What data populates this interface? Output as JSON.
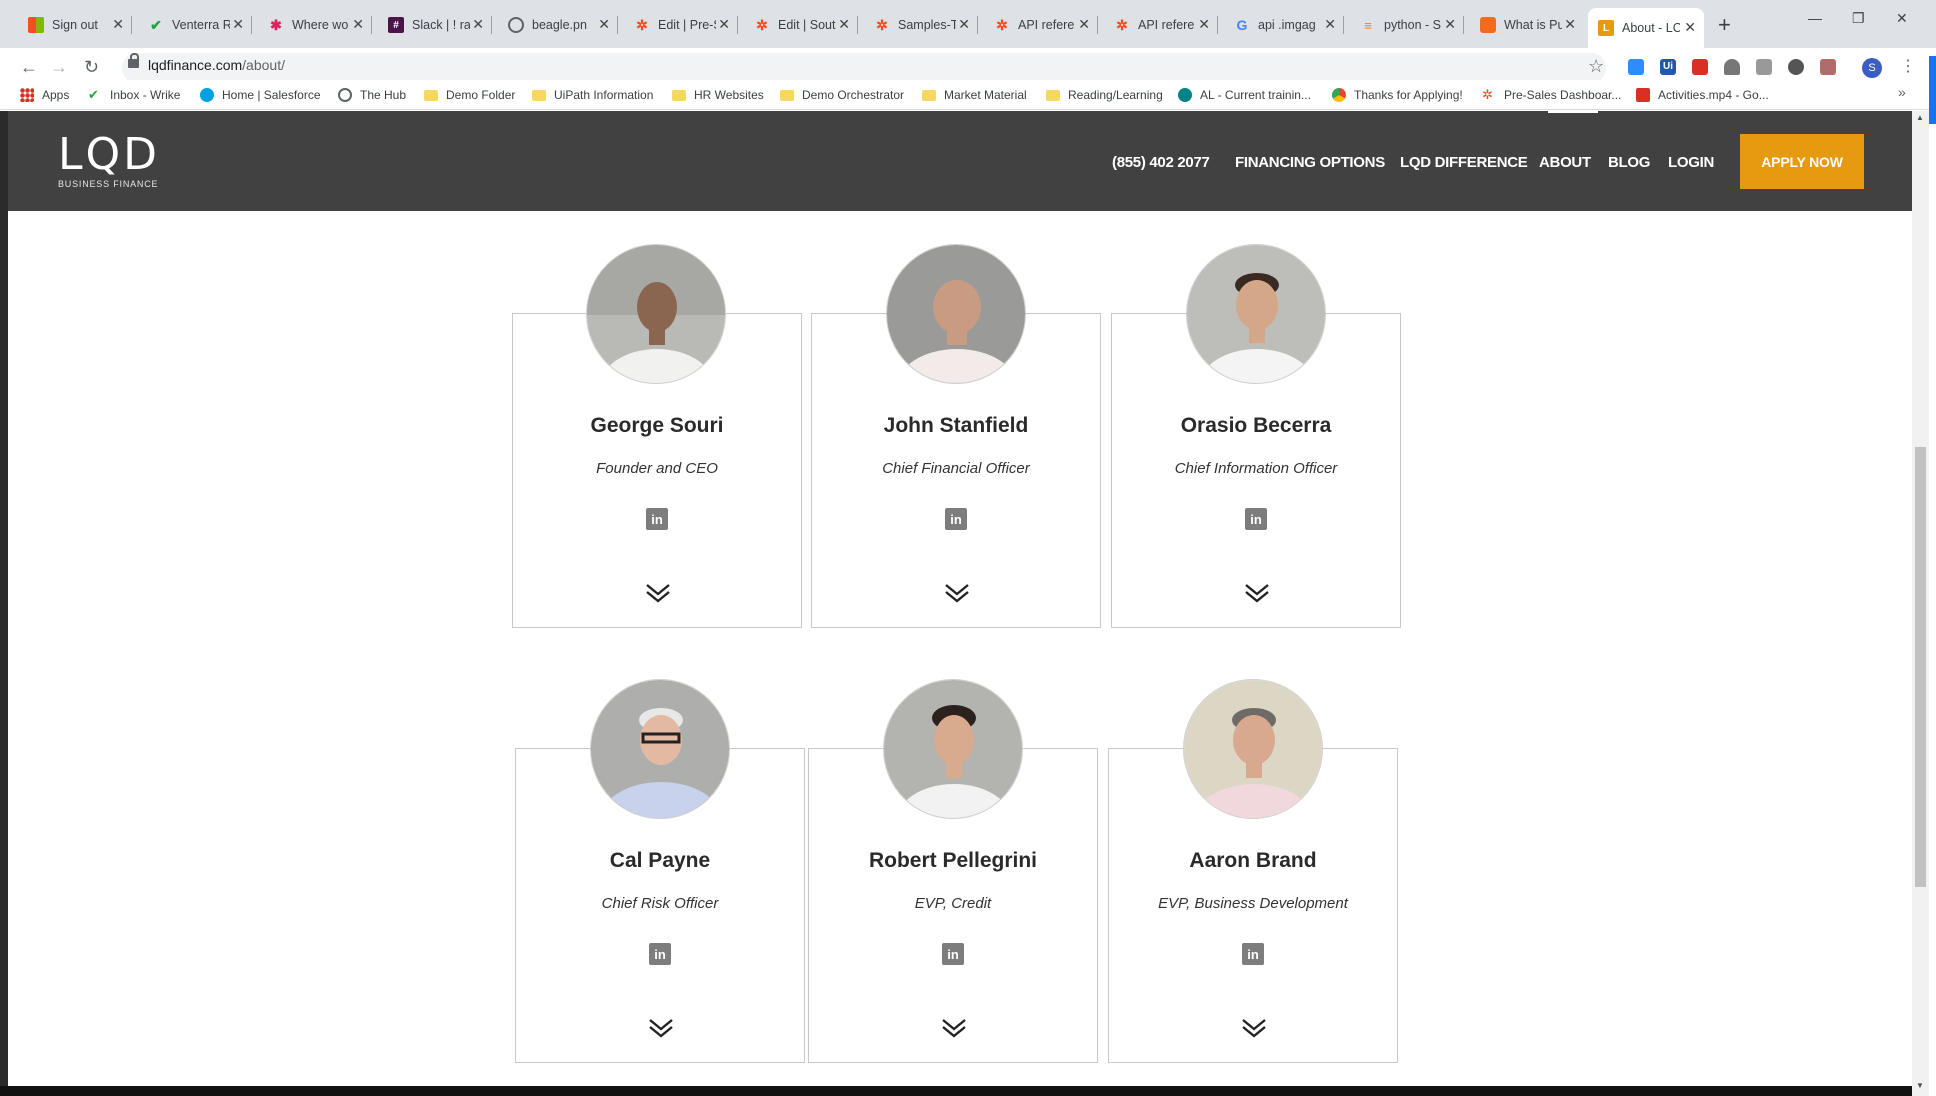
{
  "browser": {
    "tabs": [
      {
        "label": "Sign out",
        "icon": "microsoft-icon",
        "color": "#f25022"
      },
      {
        "label": "Venterra R",
        "icon": "wrike-check-icon",
        "color": "#21a340"
      },
      {
        "label": "Where wo",
        "icon": "slack-icon",
        "color": "#e01e5a"
      },
      {
        "label": "Slack | ! ra",
        "icon": "slack-square-icon",
        "color": "#4a154b"
      },
      {
        "label": "beagle.pn",
        "icon": "globe-icon",
        "color": "#5f6368"
      },
      {
        "label": "Edit | Pre-S",
        "icon": "uipath-icon",
        "color": "#fa4616"
      },
      {
        "label": "Edit | Sout",
        "icon": "uipath-icon",
        "color": "#fa4616"
      },
      {
        "label": "Samples-T",
        "icon": "uipath-icon",
        "color": "#fa4616"
      },
      {
        "label": "API refere",
        "icon": "uipath-icon",
        "color": "#fa4616"
      },
      {
        "label": "API refere",
        "icon": "uipath-icon",
        "color": "#fa4616"
      },
      {
        "label": "api .imgag",
        "icon": "google-icon",
        "color": "#4285f4"
      },
      {
        "label": "python - S",
        "icon": "stackoverflow-icon",
        "color": "#f48024"
      },
      {
        "label": "What is Pu",
        "icon": "cube-icon",
        "color": "#f26b1d"
      },
      {
        "label": "About - LC",
        "icon": "lqd-icon",
        "color": "#e69a10"
      }
    ],
    "url_host": "lqdfinance.com",
    "url_path": "/about/",
    "profile_initial": "S",
    "bookmarks": [
      {
        "label": "Apps",
        "type": "apps"
      },
      {
        "label": "Inbox - Wrike",
        "type": "wrike"
      },
      {
        "label": "Home | Salesforce",
        "type": "salesforce"
      },
      {
        "label": "The Hub",
        "type": "globe"
      },
      {
        "label": "Demo Folder",
        "type": "folder"
      },
      {
        "label": "UiPath Information",
        "type": "folder"
      },
      {
        "label": "HR Websites",
        "type": "folder"
      },
      {
        "label": "Demo Orchestrator",
        "type": "folder"
      },
      {
        "label": "Market Material",
        "type": "folder"
      },
      {
        "label": "Reading/Learning",
        "type": "folder"
      },
      {
        "label": "AL - Current trainin...",
        "type": "sharepoint"
      },
      {
        "label": "Thanks for Applying!",
        "type": "chrome"
      },
      {
        "label": "Pre-Sales Dashboar...",
        "type": "uipath"
      },
      {
        "label": "Activities.mp4 - Go...",
        "type": "calendar"
      }
    ]
  },
  "site": {
    "logo_mark": "LQD",
    "logo_sub": "BUSINESS FINANCE",
    "nav": {
      "phone": "(855) 402 2077",
      "financing": "FINANCING OPTIONS",
      "difference": "LQD DIFFERENCE",
      "about": "ABOUT",
      "blog": "BLOG",
      "login": "LOGIN",
      "apply": "APPLY NOW"
    },
    "accent_color": "#e69a10",
    "header_color": "#414141"
  },
  "team": [
    {
      "name": "George Souri",
      "title": "Founder and CEO",
      "linkedin_icon": "in"
    },
    {
      "name": "John Stanfield",
      "title": "Chief Financial Officer",
      "linkedin_icon": "in"
    },
    {
      "name": "Orasio Becerra",
      "title": "Chief Information Officer",
      "linkedin_icon": "in"
    },
    {
      "name": "Cal Payne",
      "title": "Chief Risk Officer",
      "linkedin_icon": "in"
    },
    {
      "name": "Robert Pellegrini",
      "title": "EVP, Credit",
      "linkedin_icon": "in"
    },
    {
      "name": "Aaron Brand",
      "title": "EVP, Business Development",
      "linkedin_icon": "in"
    }
  ]
}
